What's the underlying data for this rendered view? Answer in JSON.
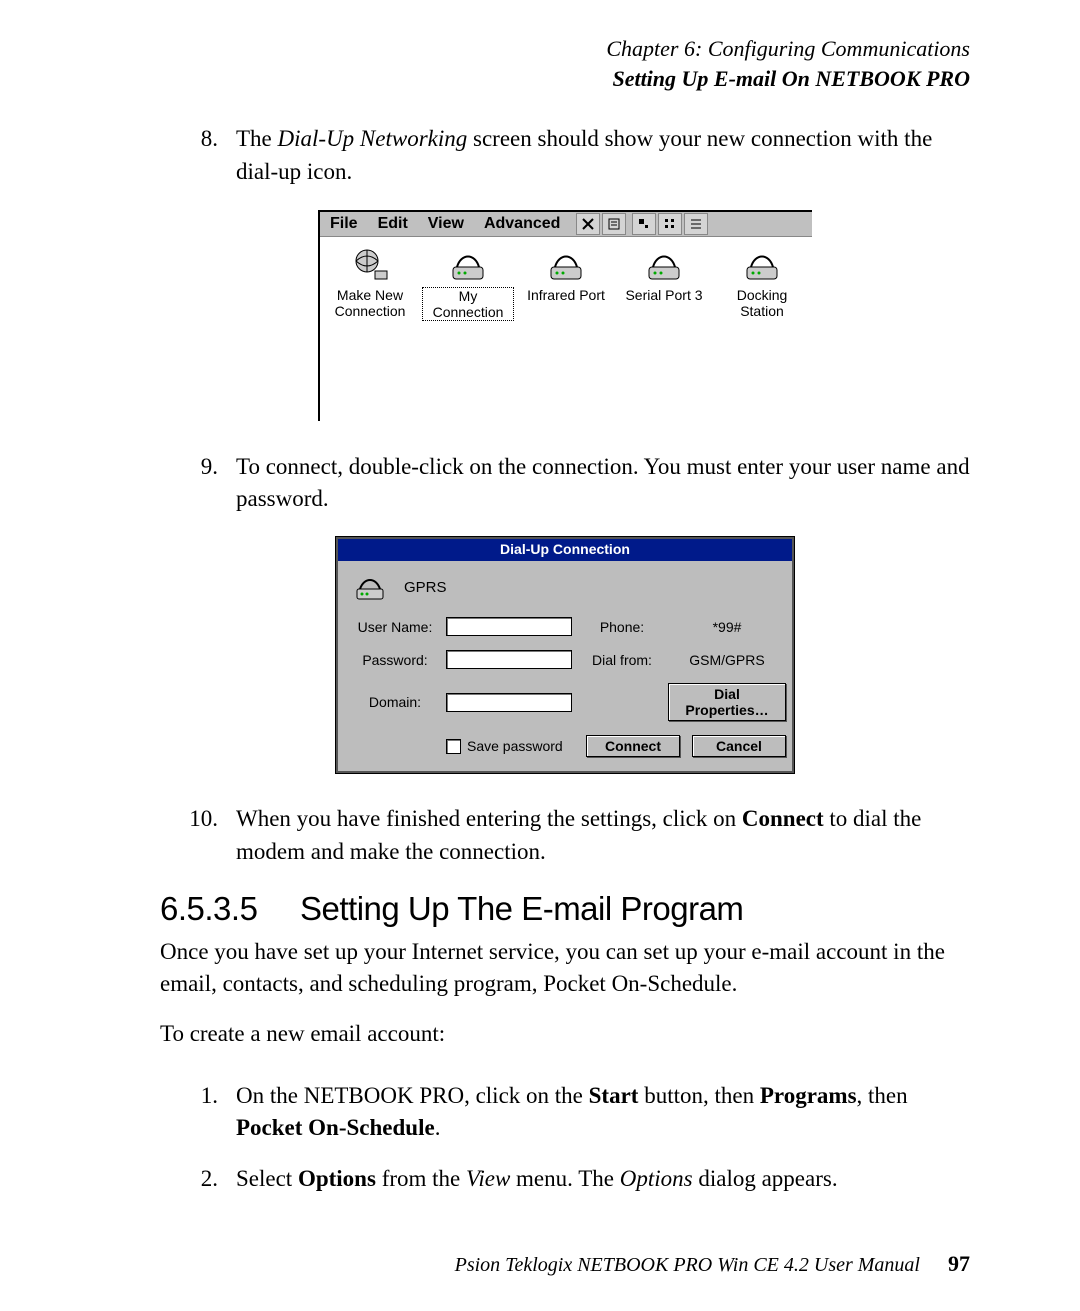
{
  "header": {
    "chapter": "Chapter 6:  Configuring Communications",
    "section": "Setting Up E-mail On NETBOOK PRO"
  },
  "steps_a": [
    {
      "num": "8.",
      "pre": "The ",
      "ital": "Dial-Up Networking",
      "post": " screen should show your new connection with the dial-up icon."
    }
  ],
  "screenshot1": {
    "menu": [
      "File",
      "Edit",
      "View",
      "Advanced"
    ],
    "toolbar_icons": [
      "close-x-icon",
      "properties-icon",
      "large-icons-icon",
      "small-icons-icon",
      "details-icon"
    ],
    "items": [
      {
        "label": "Make New Connection",
        "icon": "globe-plug-icon"
      },
      {
        "label": "My Connection",
        "icon": "modem-icon",
        "selected": true
      },
      {
        "label": "Infrared Port",
        "icon": "modem-icon"
      },
      {
        "label": "Serial Port 3",
        "icon": "modem-icon"
      },
      {
        "label": "Docking Station",
        "icon": "modem-icon"
      }
    ]
  },
  "steps_b": [
    {
      "num": "9.",
      "text": "To connect, double-click on the connection. You must enter your user name and password."
    }
  ],
  "dialog": {
    "title": "Dial-Up Connection",
    "conn_name": "GPRS",
    "labels": {
      "user": "User Name:",
      "pass": "Password:",
      "domain": "Domain:",
      "phone": "Phone:",
      "dialfrom": "Dial from:",
      "save_pw": "Save password"
    },
    "values": {
      "user": "",
      "pass": "",
      "domain": "",
      "phone": "*99#",
      "dialfrom": "GSM/GPRS"
    },
    "buttons": {
      "dialprops": "Dial Properties…",
      "connect": "Connect",
      "cancel": "Cancel"
    }
  },
  "steps_c": [
    {
      "num": "10.",
      "pre": "When you have finished entering the settings, click on ",
      "bold": "Connect",
      "post": " to dial the modem and make the connection."
    }
  ],
  "section": {
    "num": "6.5.3.5",
    "title": "Setting Up The E-mail Program"
  },
  "para1": "Once you have set up your Internet service, you can set up your e-mail account in the email, contacts, and scheduling program, Pocket On-Schedule.",
  "para2": "To create a new email account:",
  "steps_d": [
    {
      "num": "1.",
      "parts": [
        {
          "t": "On the NETBOOK PRO, click on the "
        },
        {
          "t": "Start",
          "b": true
        },
        {
          "t": " button, then "
        },
        {
          "t": "Programs",
          "b": true
        },
        {
          "t": ", then "
        },
        {
          "t": "Pocket On-Schedule",
          "b": true
        },
        {
          "t": "."
        }
      ]
    },
    {
      "num": "2.",
      "parts": [
        {
          "t": "Select "
        },
        {
          "t": "Options",
          "b": true
        },
        {
          "t": " from the "
        },
        {
          "t": "View",
          "i": true
        },
        {
          "t": " menu. The "
        },
        {
          "t": "Options",
          "i": true
        },
        {
          "t": " dialog appears."
        }
      ]
    }
  ],
  "footer": {
    "text": "Psion Teklogix NETBOOK PRO Win CE 4.2 User Manual",
    "page": "97"
  }
}
